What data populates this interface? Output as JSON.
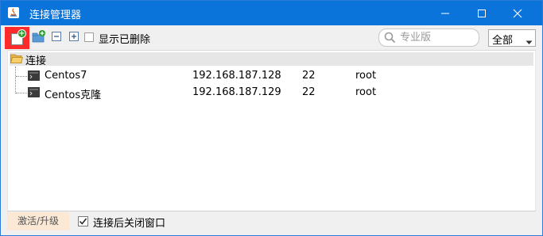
{
  "window": {
    "title": "连接管理器",
    "accent_color": "#0a74da",
    "controls": {
      "minimize": "minimize-icon",
      "maximize": "maximize-icon",
      "close": "close-icon"
    }
  },
  "toolbar": {
    "new_connection_icon": "new-connection-icon",
    "new_folder_icon": "new-folder-icon",
    "collapse_icon": "collapse-all-icon",
    "expand_icon": "expand-all-icon",
    "show_deleted_label": "显示已删除",
    "show_deleted_checked": false,
    "search_placeholder": "专业版",
    "filter_value": "全部"
  },
  "tree": {
    "root_label": "连接",
    "connections": [
      {
        "name": "Centos7",
        "host": "192.168.187.128",
        "port": "22",
        "user": "root"
      },
      {
        "name": "Centos克隆",
        "host": "192.168.187.129",
        "port": "22",
        "user": "root"
      }
    ]
  },
  "footer": {
    "activate_label": "激活/升级",
    "close_after_connect_label": "连接后关闭窗口",
    "close_after_connect_checked": true
  }
}
